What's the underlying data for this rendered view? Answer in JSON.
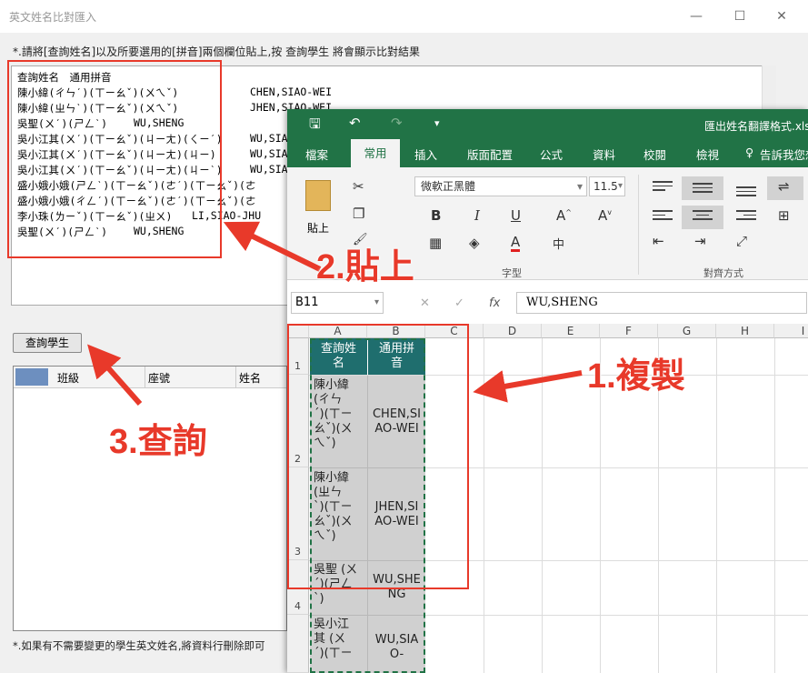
{
  "dialog": {
    "title": "英文姓名比對匯入",
    "hint": "*.請將[查詢姓名]以及所要選用的[拼音]兩個欄位貼上,按 查詢學生 將會顯示比對結果",
    "textarea": {
      "header": "查詢姓名　通用拼音",
      "lines": [
        {
          "name": "陳小緯(ㄔㄣˊ)(ㄒㄧㄠˇ)(ㄨㄟˇ)",
          "en": "CHEN,SIAO-WEI"
        },
        {
          "name": "陳小緯(ㄓㄣˋ)(ㄒㄧㄠˇ)(ㄨㄟˇ)",
          "en": "JHEN,SIAO-WEI"
        },
        {
          "name": "吳聖(ㄨˊ)(ㄕㄥˋ)",
          "en": "WU,SHENG"
        },
        {
          "name": "吳小江其(ㄨˊ)(ㄒㄧㄠˇ)(ㄐㄧㄤ)(ㄑㄧˊ)",
          "en": "WU,SIA"
        },
        {
          "name": "吳小江其(ㄨˊ)(ㄒㄧㄠˇ)(ㄐㄧㄤ)(ㄐㄧ)",
          "en": "WU,SIA"
        },
        {
          "name": "吳小江其(ㄨˊ)(ㄒㄧㄠˇ)(ㄐㄧㄤ)(ㄐㄧˋ)",
          "en": "WU,SIA"
        },
        {
          "name": "盛小娥小娥(ㄕㄥˋ)(ㄒㄧㄠˇ)(ㄜˊ)(ㄒㄧㄠˇ)(ㄜ",
          "en": ""
        },
        {
          "name": "盛小娥小娥(ㄔㄥˊ)(ㄒㄧㄠˇ)(ㄜˊ)(ㄒㄧㄠˇ)(ㄜ",
          "en": ""
        },
        {
          "name": "李小珠(ㄌㄧˇ)(ㄒㄧㄠˇ)(ㄓㄨ)",
          "en": "LI,SIAO-JHU"
        },
        {
          "name": "吳聖(ㄨˊ)(ㄕㄥˋ)",
          "en": "WU,SHENG"
        }
      ]
    },
    "query_button": "查詢學生",
    "grid_headers": [
      "班級",
      "座號",
      "姓名"
    ],
    "footer": "*.如果有不需要變更的學生英文姓名,將資料行刪除即可"
  },
  "excel": {
    "title": "匯出姓名翻譯格式.xlsx",
    "tabs": [
      "檔案",
      "常用",
      "插入",
      "版面配置",
      "公式",
      "資料",
      "校閱",
      "檢視",
      "告訴我您想"
    ],
    "active_tab": "常用",
    "paste_label": "貼上",
    "font_name": "微軟正黑體",
    "font_size": "11.5",
    "group_font": "字型",
    "group_align": "對齊方式",
    "name_box": "B11",
    "formula": "WU,SHENG",
    "columns": [
      "A",
      "B",
      "C",
      "D",
      "E",
      "F",
      "G",
      "H",
      "I"
    ],
    "rows": [
      {
        "num": "1",
        "a": "查詢姓\n名",
        "b": "通用拼\n音"
      },
      {
        "num": "2",
        "a": "陳小緯\n(ㄔㄣ\nˊ)(ㄒㄧ\nㄠˇ)(ㄨ\nㄟˇ)",
        "b": "CHEN,SI\nAO-WEI"
      },
      {
        "num": "3",
        "a": "陳小緯\n(ㄓㄣ\nˋ)(ㄒㄧ\nㄠˇ)(ㄨ\nㄟˇ)",
        "b": "JHEN,SI\nAO-WEI"
      },
      {
        "num": "4",
        "a": "吳聖 (ㄨ\nˊ)(ㄕㄥ\nˋ)",
        "b": "WU,SHE\nNG"
      },
      {
        "num": "",
        "a": "吳小江\n其 (ㄨ\nˊ)(ㄒㄧ",
        "b": "WU,SIA\nO-"
      }
    ]
  },
  "annotations": {
    "copy": "1.複製",
    "paste": "2.貼上",
    "query": "3.查詢"
  },
  "colors": {
    "excel_green": "#217346",
    "annotation_red": "#e8392a",
    "header_teal": "#1f6e6e"
  }
}
